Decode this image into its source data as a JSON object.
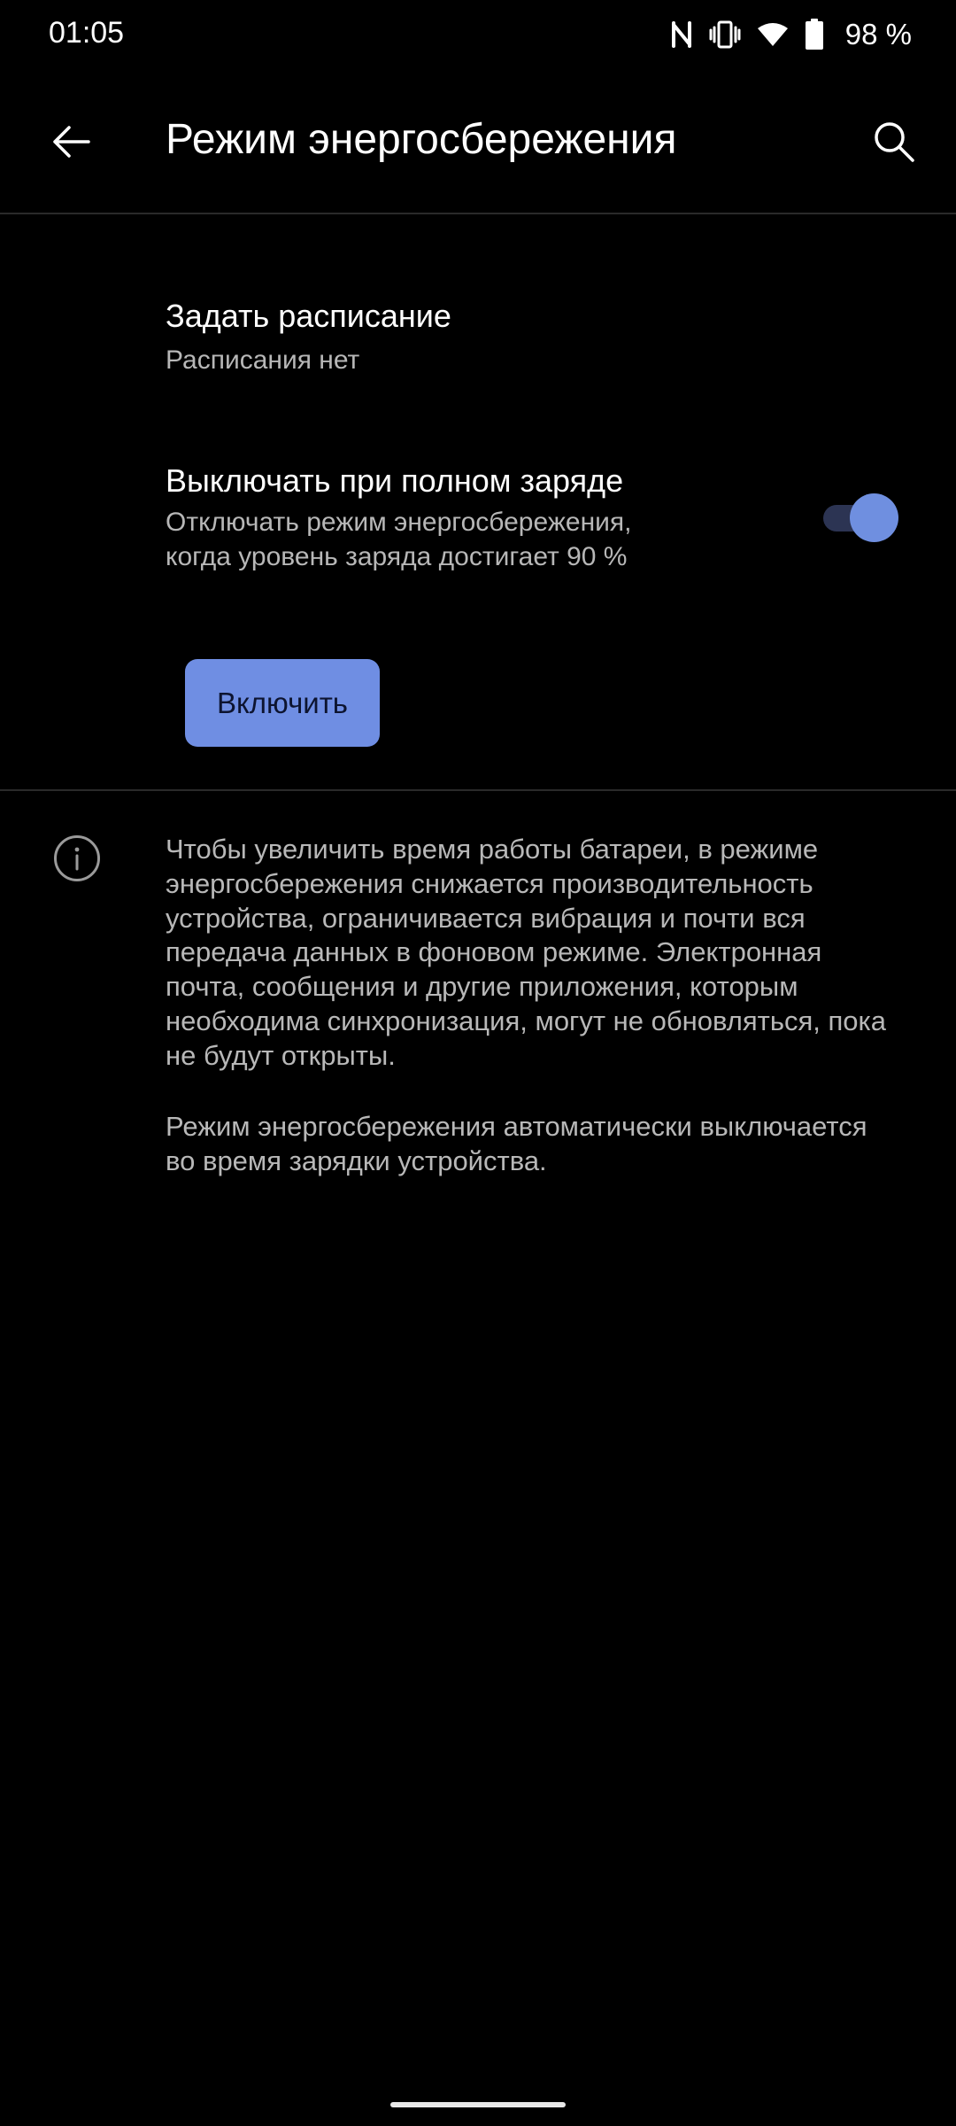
{
  "status_bar": {
    "time": "01:05",
    "battery_percent": "98 %",
    "icons": [
      "nfc-icon",
      "vibrate-icon",
      "wifi-icon",
      "battery-icon"
    ]
  },
  "app_bar": {
    "title": "Режим энергосбережения",
    "back_icon": "arrow-back-icon",
    "search_icon": "search-icon"
  },
  "settings": {
    "schedule": {
      "title": "Задать расписание",
      "summary": "Расписания нет"
    },
    "turn_off_when_charged": {
      "title": "Выключать при полном заряде",
      "summary_line1": "Отключать режим энергосбережения,",
      "summary_line2": "когда уровень заряда достигает 90 %",
      "enabled": true
    },
    "enable_button_label": "Включить"
  },
  "info": {
    "icon": "info-icon",
    "paragraph1": "Чтобы увеличить время работы батареи, в режиме энергосбережения снижается производительность устройства, ограничивается вибрация и почти вся передача данных в фоновом режиме. Электронная почта, сообщения и другие приложения, которым необходима синхронизация, могут не обновляться, пока не будут открыты.",
    "paragraph2": "Режим энергосбережения автоматически выключается во время зарядки устройства."
  },
  "colors": {
    "background": "#000000",
    "accent": "#6f8fe0",
    "toggle_track": "#2c3453",
    "secondary_text": "#b7b7b7"
  }
}
